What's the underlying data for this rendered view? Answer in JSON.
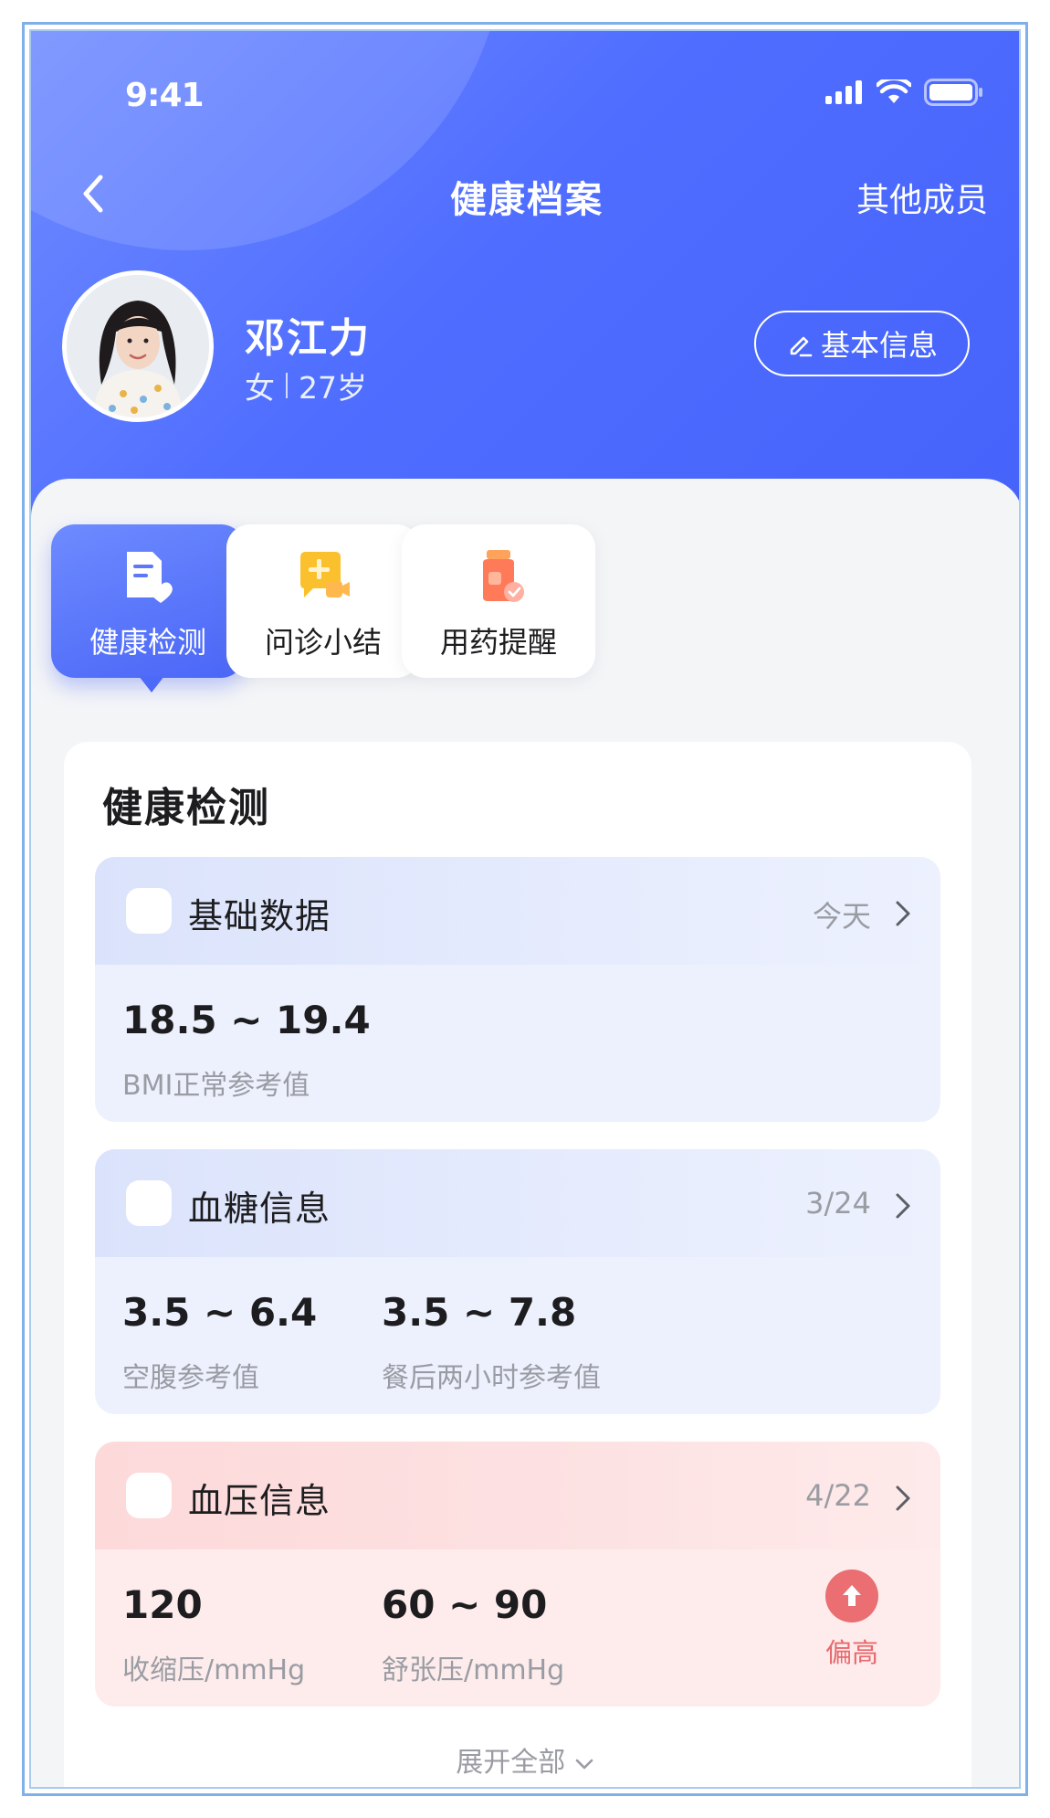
{
  "status_bar": {
    "time": "9:41"
  },
  "nav": {
    "title": "健康档案",
    "right_label": "其他成员"
  },
  "profile": {
    "name": "邓江力",
    "gender": "女",
    "age": "27岁",
    "edit_label": "基本信息"
  },
  "tabs": [
    {
      "label": "健康检测",
      "icon": "heart-file-icon",
      "active": true
    },
    {
      "label": "问诊小结",
      "icon": "chat-video-icon",
      "active": false
    },
    {
      "label": "用药提醒",
      "icon": "medicine-bottle-icon",
      "active": false
    }
  ],
  "section": {
    "title": "健康检测",
    "panels": [
      {
        "title": "基础数据",
        "date": "今天",
        "metrics": [
          {
            "value": "18.5 ~ 19.4",
            "label": "BMI正常参考值"
          }
        ]
      },
      {
        "title": "血糖信息",
        "date": "3/24",
        "metrics": [
          {
            "value": "3.5 ~ 6.4",
            "label": "空腹参考值"
          },
          {
            "value": "3.5 ~ 7.8",
            "label": "餐后两小时参考值"
          }
        ]
      },
      {
        "title": "血压信息",
        "date": "4/22",
        "metrics": [
          {
            "value": "120",
            "label": "收缩压/mmHg"
          },
          {
            "value": "60 ~ 90",
            "label": "舒张压/mmHg"
          }
        ],
        "alert": {
          "label": "偏高",
          "icon": "arrow-up-circle-icon"
        }
      }
    ],
    "expand_label": "展开全部"
  },
  "colors": {
    "brand": "#4f6dff",
    "alert": "#ea6e72"
  }
}
